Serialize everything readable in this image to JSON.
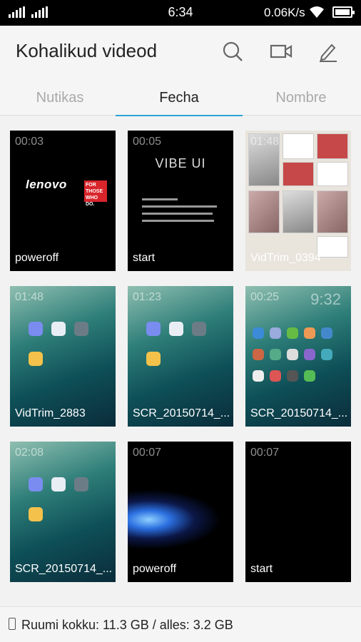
{
  "status_bar": {
    "time": "6:34",
    "net_speed": "0.06K/s",
    "sim_icons": [
      "signal-icon",
      "signal-2-icon",
      "wifi-icon",
      "battery-icon"
    ]
  },
  "header": {
    "title": "Kohalikud videod",
    "icons": [
      "search-icon",
      "video-camera-icon",
      "edit-icon"
    ]
  },
  "tabs": [
    {
      "label": "Nutikas",
      "active": false
    },
    {
      "label": "Fecha",
      "active": true
    },
    {
      "label": "Nombre",
      "active": false
    }
  ],
  "videos": [
    {
      "duration": "00:03",
      "name": "poweroff",
      "thumb": "lenovo-logo"
    },
    {
      "duration": "00:05",
      "name": "start",
      "thumb": "vibe-ui-notice"
    },
    {
      "duration": "01:48",
      "name": "VidTrim_0394",
      "thumb": "app-collage"
    },
    {
      "duration": "01:48",
      "name": "VidTrim_2883",
      "thumb": "home-screen"
    },
    {
      "duration": "01:23",
      "name": "SCR_20150714_...",
      "thumb": "home-screen"
    },
    {
      "duration": "00:25",
      "name": "SCR_20150714_...",
      "thumb": "lock-home-screen"
    },
    {
      "duration": "02:08",
      "name": "SCR_20150714_...",
      "thumb": "home-screen"
    },
    {
      "duration": "00:07",
      "name": "poweroff",
      "thumb": "blue-particles"
    },
    {
      "duration": "00:07",
      "name": "start",
      "thumb": "black"
    }
  ],
  "thumb_text": {
    "lenovo": "lenovo",
    "lenovo_badge": "FOR THOSE WHO DO.",
    "vibe": "VIBE UI",
    "clock": "9:32"
  },
  "footer": {
    "storage": "Ruumi kokku: 11.3 GB / alles: 3.2 GB"
  },
  "colors": {
    "accent": "#2ba3d6",
    "tile_bg": "#000000"
  }
}
